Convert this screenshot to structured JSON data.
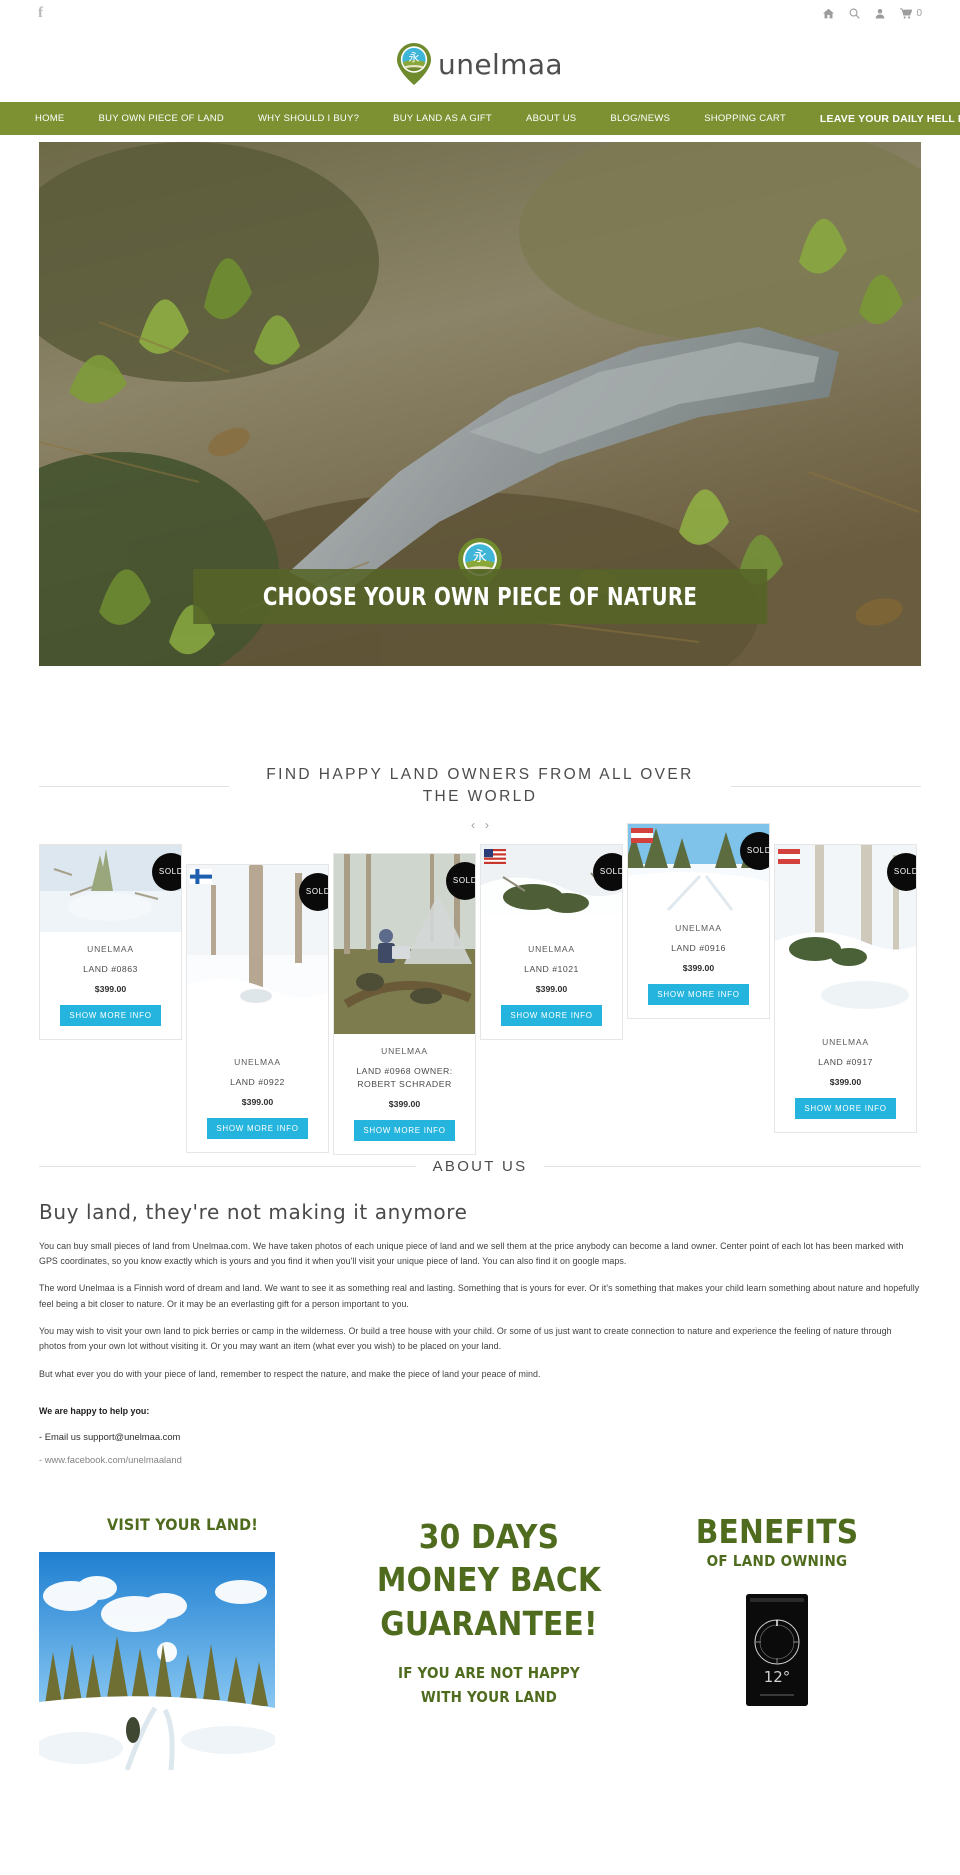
{
  "topbar": {
    "facebook_icon": "facebook-icon",
    "icons": [
      "home-icon",
      "search-icon",
      "account-icon",
      "cart-icon"
    ],
    "cart_count": "0"
  },
  "branding": {
    "logo_word": "unelmaa",
    "logo_icon": "unelmaa-pin-logo"
  },
  "nav": {
    "items": [
      {
        "label": "HOME",
        "bold": false
      },
      {
        "label": "BUY OWN PIECE OF LAND",
        "bold": false
      },
      {
        "label": "WHY SHOULD I BUY?",
        "bold": false
      },
      {
        "label": "BUY LAND AS A GIFT",
        "bold": false
      },
      {
        "label": "ABOUT US",
        "bold": false
      },
      {
        "label": "BLOG/NEWS",
        "bold": false
      },
      {
        "label": "SHOPPING CART",
        "bold": false
      },
      {
        "label": "LEAVE YOUR DAILY HELL EXPERIENCE",
        "bold": true
      }
    ]
  },
  "hero": {
    "caption": "CHOOSE YOUR OWN PIECE OF NATURE",
    "pin_icon": "unelmaa-pin-logo"
  },
  "products_section": {
    "title": "FIND HAPPY LAND OWNERS FROM ALL OVER THE WORLD",
    "prev_arrow": "‹",
    "next_arrow": "›",
    "cards": [
      {
        "brand": "UNELMAA",
        "name": "LAND #0863",
        "price": "$399.00",
        "button": "SHOW MORE INFO",
        "badge": "SOLD",
        "flag": "none"
      },
      {
        "brand": "UNELMAA",
        "name": "LAND #0922",
        "price": "$399.00",
        "button": "SHOW MORE INFO",
        "badge": "SOLD",
        "flag": "finland"
      },
      {
        "brand": "UNELMAA",
        "name": "LAND #0968 OWNER: ROBERT SCHRADER",
        "price": "$399.00",
        "button": "SHOW MORE INFO",
        "badge": "SOLD",
        "flag": "none"
      },
      {
        "brand": "UNELMAA",
        "name": "LAND #1021",
        "price": "$399.00",
        "button": "SHOW MORE INFO",
        "badge": "SOLD",
        "flag": "usa"
      },
      {
        "brand": "UNELMAA",
        "name": "LAND #0916",
        "price": "$399.00",
        "button": "SHOW MORE INFO",
        "badge": "SOLD",
        "flag": "austria"
      },
      {
        "brand": "UNELMAA",
        "name": "LAND #0917",
        "price": "$399.00",
        "button": "SHOW MORE INFO",
        "badge": "SOLD",
        "flag": "austria"
      }
    ]
  },
  "about": {
    "title": "ABOUT US",
    "heading": "Buy land, they're not making it anymore",
    "paragraphs": [
      "You can buy small pieces of land from Unelmaa.com. We have taken photos of each unique piece of land and we sell them at the price anybody can become a land owner. Center point of each lot has been marked with GPS coordinates, so you know exactly which is yours and you find it when you'll visit your unique piece of land. You can also find it on google maps.",
      "The word Unelmaa is a Finnish word of dream and land. We want to see it as something real and lasting. Something that is yours for ever. Or it's something that makes your child learn something about nature and hopefully feel being a bit closer to nature. Or it may be an everlasting gift for a person important to you.",
      "You may wish to visit your own land to pick berries or camp in the wilderness. Or build a tree house with your child. Or some of us just want to create connection to nature and experience the feeling of nature through photos from your own lot without visiting it. Or you may want an item (what ever you wish) to be placed on your land.",
      "But what ever you do with your piece of land, remember to respect the nature, and make the piece of land your peace of mind."
    ],
    "help_title": "We are happy to help you:",
    "email_line": "- Email us support@unelmaa.com",
    "facebook_line": "- www.facebook.com/unelmaaland"
  },
  "bottom": {
    "visit": {
      "title": "VISIT YOUR LAND!",
      "photo_alt": "snowy-forest-trail-photo"
    },
    "guarantee": {
      "line1": "30 DAYS",
      "line2": "MONEY BACK",
      "line3": "GUARANTEE!",
      "sub1": "IF YOU ARE NOT HAPPY",
      "sub2": "WITH YOUR LAND"
    },
    "benefits": {
      "title": "BENEFITS",
      "subtitle": "OF LAND OWNING",
      "phone_alt": "compass-app-phone"
    }
  },
  "colors": {
    "nav_green": "#7d9133",
    "button_blue": "#24b4dd",
    "heading_green": "#4f6b1e",
    "badge_black": "#0a0a0a"
  }
}
